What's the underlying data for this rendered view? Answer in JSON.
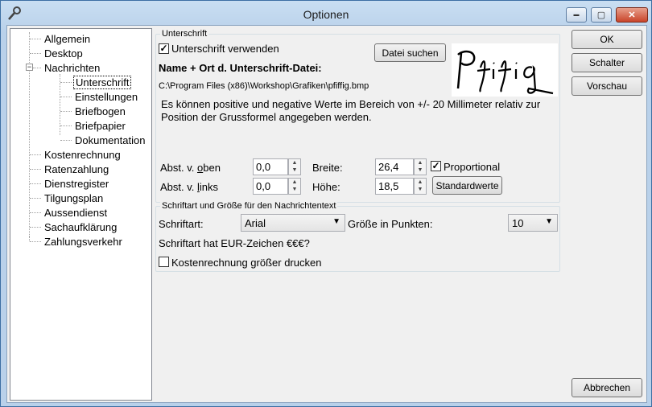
{
  "window": {
    "title": "Optionen",
    "minimize": "▬",
    "maximize": "▢",
    "close": "✕"
  },
  "tree": {
    "items": [
      {
        "label": "Allgemein"
      },
      {
        "label": "Desktop"
      },
      {
        "label": "Nachrichten",
        "expanded": true
      },
      {
        "label": "Unterschrift",
        "selected": true
      },
      {
        "label": "Einstellungen"
      },
      {
        "label": "Briefbogen"
      },
      {
        "label": "Briefpapier"
      },
      {
        "label": "Dokumentation"
      },
      {
        "label": "Kostenrechnung"
      },
      {
        "label": "Ratenzahlung"
      },
      {
        "label": "Dienstregister"
      },
      {
        "label": "Tilgungsplan"
      },
      {
        "label": "Aussendienst"
      },
      {
        "label": "Sachaufklärung"
      },
      {
        "label": "Zahlungsverkehr"
      }
    ],
    "expander": "−"
  },
  "signature": {
    "group_label": "Unterschrift",
    "use_signature_label": "Unterschrift verwenden",
    "use_signature_checked": true,
    "file_heading": "Name + Ort d. Unterschrift-Datei:",
    "file_path": "C:\\Program Files (x86)\\Workshop\\Grafiken\\pfiffig.bmp",
    "search_button": "Datei suchen",
    "info_text_1": "Es können positive und negative Werte im Bereich von +/- 20 Millimeter relativ zur",
    "info_text_2": "Position der Grussformel angegeben werden.",
    "offset_top_label_pre": "Abst. v. ",
    "offset_top_label_key": "o",
    "offset_top_label_post": "ben",
    "offset_top_value": "0,0",
    "offset_left_label_pre": "Abst. v. ",
    "offset_left_label_key": "l",
    "offset_left_label_post": "inks",
    "offset_left_value": "0,0",
    "width_label": "Breite:",
    "width_value": "26,4",
    "height_label": "Höhe:",
    "height_value": "18,5",
    "proportional_label": "Proportional",
    "proportional_checked": true,
    "defaults_button": "Standardwerte",
    "image_text": "Pfiffig"
  },
  "font": {
    "group_label": "Schriftart und Größe für den Nachrichtentext",
    "font_label": "Schriftart:",
    "font_value": "Arial",
    "size_label": "Größe in Punkten:",
    "size_value": "10",
    "euro_text": "Schriftart hat EUR-Zeichen €€€?",
    "cost_print_label": "Kostenrechnung größer drucken",
    "cost_print_checked": false
  },
  "buttons": {
    "ok": "OK",
    "schalter": "Schalter",
    "preview": "Vorschau",
    "cancel": "Abbrechen"
  },
  "colors": {
    "title_bar": "#b9d1ea",
    "close_button": "#c9442a",
    "selection_border": "#000000"
  }
}
